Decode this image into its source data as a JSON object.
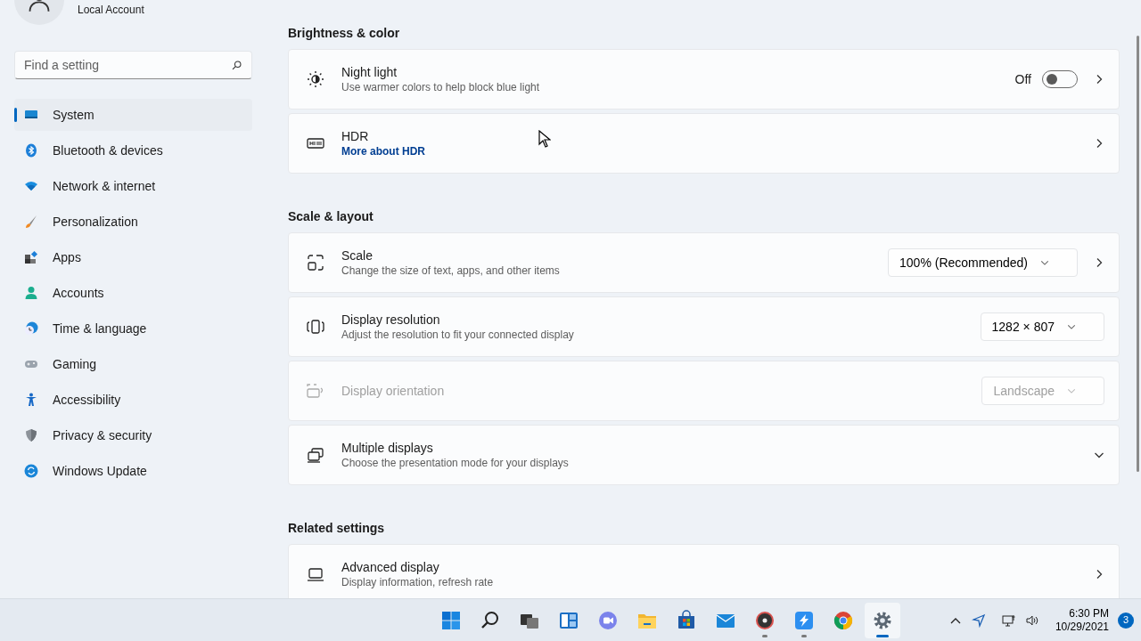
{
  "account": {
    "label": "Local Account"
  },
  "search": {
    "placeholder": "Find a setting"
  },
  "sidebar": {
    "items": [
      {
        "label": "System",
        "selected": true
      },
      {
        "label": "Bluetooth & devices",
        "selected": false
      },
      {
        "label": "Network & internet",
        "selected": false
      },
      {
        "label": "Personalization",
        "selected": false
      },
      {
        "label": "Apps",
        "selected": false
      },
      {
        "label": "Accounts",
        "selected": false
      },
      {
        "label": "Time & language",
        "selected": false
      },
      {
        "label": "Gaming",
        "selected": false
      },
      {
        "label": "Accessibility",
        "selected": false
      },
      {
        "label": "Privacy & security",
        "selected": false
      },
      {
        "label": "Windows Update",
        "selected": false
      }
    ]
  },
  "sections": [
    {
      "heading": "Brightness & color",
      "rows": [
        {
          "kind": "toggle",
          "title": "Night light",
          "subtitle": "Use warmer colors to help block blue light",
          "state_label": "Off",
          "on": false,
          "disabled": false,
          "chevron": true
        },
        {
          "kind": "link",
          "title": "HDR",
          "link": "More about HDR",
          "disabled": false,
          "chevron": true
        }
      ]
    },
    {
      "heading": "Scale & layout",
      "rows": [
        {
          "kind": "dropdown",
          "title": "Scale",
          "subtitle": "Change the size of text, apps, and other items",
          "value": "100% (Recommended)",
          "disabled": false,
          "chevron": true
        },
        {
          "kind": "dropdown",
          "title": "Display resolution",
          "subtitle": "Adjust the resolution to fit your connected display",
          "value": "1282 × 807",
          "disabled": false,
          "chevron": false
        },
        {
          "kind": "dropdown",
          "title": "Display orientation",
          "value": "Landscape",
          "disabled": true,
          "chevron": false
        },
        {
          "kind": "expander",
          "title": "Multiple displays",
          "subtitle": "Choose the presentation mode for your displays",
          "expanded": false,
          "disabled": false,
          "chevron": false
        }
      ]
    },
    {
      "heading": "Related settings",
      "rows": [
        {
          "kind": "plain",
          "title": "Advanced display",
          "subtitle": "Display information, refresh rate",
          "disabled": false,
          "chevron": true
        }
      ]
    }
  ],
  "taskbar": {
    "apps": [
      {
        "running": false,
        "active": false
      },
      {
        "running": false,
        "active": false
      },
      {
        "running": false,
        "active": false
      },
      {
        "running": false,
        "active": false
      },
      {
        "running": false,
        "active": false
      },
      {
        "running": false,
        "active": false
      },
      {
        "running": false,
        "active": false
      },
      {
        "running": false,
        "active": false
      },
      {
        "running": true,
        "active": false
      },
      {
        "running": true,
        "active": false
      },
      {
        "running": false,
        "active": false
      },
      {
        "running": true,
        "active": true
      }
    ],
    "clock": {
      "time": "6:30 PM",
      "date": "10/29/2021"
    },
    "notifications": "3"
  }
}
